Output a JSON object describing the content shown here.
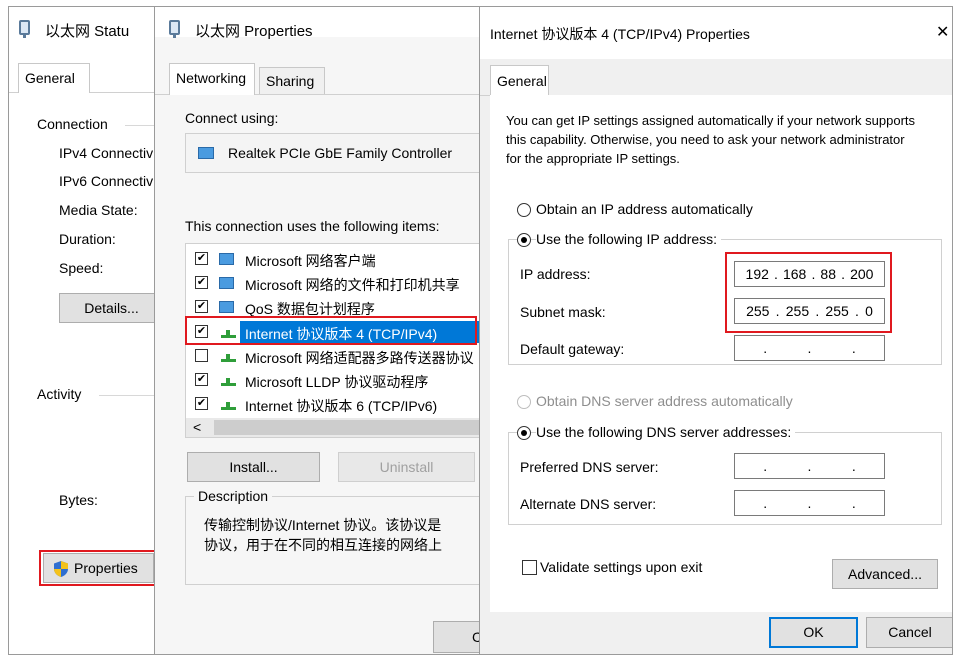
{
  "status_window": {
    "title": "以太网 Statu",
    "tab_general": "General",
    "connection_label": "Connection",
    "ipv4_label": "IPv4 Connectiv",
    "ipv6_label": "IPv6 Connectiv",
    "media_state_label": "Media State:",
    "duration_label": "Duration:",
    "speed_label": "Speed:",
    "details_button": "Details...",
    "activity_label": "Activity",
    "bytes_label": "Bytes:",
    "properties_button": "Properties"
  },
  "properties_window": {
    "title": "以太网 Properties",
    "tab_networking": "Networking",
    "tab_sharing": "Sharing",
    "connect_using_label": "Connect using:",
    "adapter_name": "Realtek PCIe GbE Family Controller",
    "items_label": "This connection uses the following items:",
    "items": [
      {
        "label": "Microsoft 网络客户端",
        "checked": "✔"
      },
      {
        "label": "Microsoft 网络的文件和打印机共享",
        "checked": "✔"
      },
      {
        "label": "QoS 数据包计划程序",
        "checked": "✔"
      },
      {
        "label": "Internet 协议版本 4 (TCP/IPv4)",
        "checked": "✔"
      },
      {
        "label": "Microsoft 网络适配器多路传送器协议",
        "checked": ""
      },
      {
        "label": "Microsoft LLDP 协议驱动程序",
        "checked": "✔"
      },
      {
        "label": "Internet 协议版本 6 (TCP/IPv6)",
        "checked": "✔"
      }
    ],
    "scroll_left": "<",
    "install_button": "Install...",
    "uninstall_button": "Uninstall",
    "description_label": "Description",
    "description_line1": "传输控制协议/Internet 协议。该协议是",
    "description_line2": "协议，用于在不同的相互连接的网络上",
    "ok_partial": "C"
  },
  "ipv4_window": {
    "title": "Internet 协议版本 4 (TCP/IPv4) Properties",
    "close_glyph": "✕",
    "tab_general": "General",
    "intro_line1": "You can get IP settings assigned automatically if your network supports",
    "intro_line2": "this capability. Otherwise, you need to ask your network administrator",
    "intro_line3": "for the appropriate IP settings.",
    "obtain_ip_auto": "Obtain an IP address automatically",
    "use_following_ip": "Use the following IP address:",
    "ip_address_label": "IP address:",
    "ip_address": [
      "192",
      "168",
      "88",
      "200"
    ],
    "subnet_mask_label": "Subnet mask:",
    "subnet_mask": [
      "255",
      "255",
      "255",
      "0"
    ],
    "default_gateway_label": "Default gateway:",
    "obtain_dns_auto": "Obtain DNS server address automatically",
    "use_following_dns": "Use the following DNS server addresses:",
    "preferred_dns_label": "Preferred DNS server:",
    "alternate_dns_label": "Alternate DNS server:",
    "dot": ".",
    "validate_label": "Validate settings upon exit",
    "advanced_button": "Advanced...",
    "ok_button": "OK",
    "cancel_button": "Cancel"
  },
  "colors": {
    "highlight_red": "#e0191f",
    "selection_blue": "#0078d7"
  }
}
